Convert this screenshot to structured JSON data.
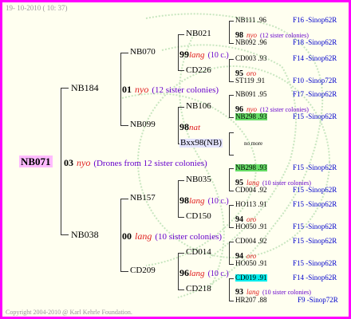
{
  "date": "19- 10-2010 ( 10: 37)",
  "copyright": "Copyright 2004-2010 @ Karl Kehrle Foundation.",
  "root": {
    "name": "NB071",
    "queen_year": "03",
    "race": "nyo",
    "note": "(Drones from 12 sister colonies)"
  },
  "gen1": {
    "top": {
      "name": "NB184",
      "queen_year": "01",
      "race": "nyo",
      "note": "(12 sister colonies)"
    },
    "bottom": {
      "name": "NB038",
      "queen_year": "00",
      "race": "lang",
      "note": "(10 sister colonies)"
    }
  },
  "gen2": {
    "nb070": {
      "name": "NB070",
      "queen_year": "99",
      "race": "lang",
      "note": "(10 c.)"
    },
    "nb099": {
      "name": "NB099",
      "queen_year": "98",
      "race": "nat"
    },
    "nb157": {
      "name": "NB157",
      "queen_year": "98",
      "race": "lang",
      "note": "(10 c.)"
    },
    "cd209": {
      "name": "CD209",
      "queen_year": "96",
      "race": "lang",
      "note": "(10 c.)"
    }
  },
  "gen3": {
    "nb021": {
      "name": "NB021",
      "queen_year": "98",
      "race": "nyo",
      "note": "(12 sister colonies)"
    },
    "cd226": {
      "name": "CD226",
      "queen_year": "95",
      "race": "oro"
    },
    "nb106": {
      "name": "NB106",
      "queen_year": "96",
      "race": "nyo",
      "note": "(12 sister colonies)"
    },
    "bxx98": {
      "name": "Bxx98(NB)",
      "note": "no more"
    },
    "nb035": {
      "name": "NB035",
      "queen_year": "95",
      "race": "lang",
      "note": "(10 sister colonies)"
    },
    "cd150": {
      "name": "CD150",
      "queen_year": "94",
      "race": "oro"
    },
    "cd014": {
      "name": "CD014",
      "queen_year": "94",
      "race": "oro"
    },
    "cd218": {
      "name": "CD218",
      "queen_year": "93",
      "race": "lang",
      "note": "(10 sister colonies)"
    }
  },
  "leaves": [
    {
      "id": "NB111 .96",
      "src": "F16 -Sinop62R"
    },
    {
      "id": "NB092 .96",
      "src": "F18 -Sinop62R"
    },
    {
      "id": "CD003 .93",
      "src": "F14 -Sinop62R"
    },
    {
      "id": "ST119 .91",
      "src": "F10 -Sinop72R"
    },
    {
      "id": "NB091 .95",
      "src": "F17 -Sinop62R"
    },
    {
      "id": "NB298 .93",
      "src": "F15 -Sinop62R"
    },
    {
      "id": "NB298 .93",
      "src": "F15 -Sinop62R"
    },
    {
      "id": "CD004 .92",
      "src": "F15 -Sinop62R"
    },
    {
      "id": "HO113 .91",
      "src": "F15 -Sinop62R"
    },
    {
      "id": "HO050 .91",
      "src": "F15 -Sinop62R"
    },
    {
      "id": "CD004 .92",
      "src": "F15 -Sinop62R"
    },
    {
      "id": "HO050 .91",
      "src": "F15 -Sinop62R"
    },
    {
      "id": "CD019 .91",
      "src": "F14 -Sinop62R"
    },
    {
      "id": "HR207 .88",
      "src": "F9 -Sinop72R"
    }
  ],
  "colors": {
    "border": "#ff00ff",
    "background": "#fffff0",
    "race": "#e02020",
    "note": "#6600cc",
    "source": "#0000cc",
    "highlight_green": "#66dd66",
    "highlight_cyan": "#00eeee"
  }
}
